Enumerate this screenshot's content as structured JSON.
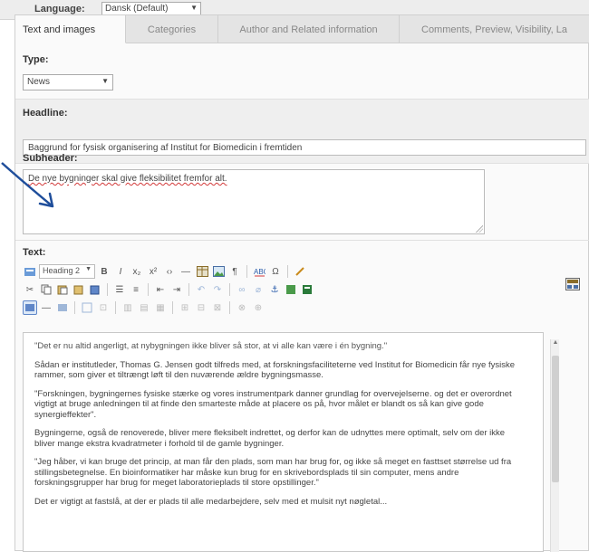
{
  "language": {
    "label": "Language:",
    "value": "Dansk (Default)"
  },
  "tabs": [
    {
      "label": "Text and images"
    },
    {
      "label": "Categories"
    },
    {
      "label": "Author and Related information"
    },
    {
      "label": "Comments, Preview, Visibility, La"
    }
  ],
  "type": {
    "label": "Type:",
    "value": "News"
  },
  "headline": {
    "label": "Headline:",
    "value": "Baggrund for fysisk organisering af Institut for Biomedicin i fremtiden"
  },
  "subheader": {
    "label": "Subheader:",
    "value": "De nye bygninger skal give fleksibilitet fremfor alt."
  },
  "text": {
    "label": "Text:",
    "format": "Heading 2",
    "paragraphs": [
      "\"Det er nu altid angerligt, at nybygningen ikke bliver så stor, at vi alle kan være i én bygning.\"",
      "Sådan er institutleder, Thomas G. Jensen godt tilfreds med, at forskningsfaciliteterne ved Institut for Biomedicin får nye fysiske rammer, som giver et tiltrængt løft til den nuværende ældre bygningsmasse.",
      "\"Forskningen, bygningernes fysiske stærke og  vores instrumentpark danner grundlag for overvejelserne.  og det er overordnet vigtigt at bruge anledningen til at finde den smarteste måde at placere os på, hvor målet er blandt os så kan give gode synergieffekter\".",
      "Bygningerne, også de renoverede, bliver mere fleksibelt indrettet, og derfor kan de udnyttes mere optimalt, selv om der ikke bliver mange ekstra kvadratmeter i forhold til de gamle bygninger.",
      "\"Jeg håber, vi kan bruge det princip, at man får den plads, som man har brug for, og ikke så meget en fasttset størrelse ud fra stillingsbetegnelse. En bioinformatiker har måske kun brug for en skrivebordsplads til sin computer, mens andre forskningsgrupper har brug for meget laboratorieplads til store opstillinger.\"",
      "Det er vigtigt at fastslå, at der er plads til alle medarbejdere, selv med et mulsit nyt nøgletal..."
    ]
  },
  "icons": {
    "toolbar1": [
      "format-select",
      "bold-icon",
      "italic-icon",
      "subscript-icon",
      "superscript-icon",
      "horizontal-rule-icon",
      "table-icon",
      "image-icon",
      "paragraph-icon",
      "spellcheck-icon",
      "special-char-icon",
      "pen-icon"
    ],
    "toolbar2": [
      "cut-icon",
      "copy-icon",
      "paste-icon",
      "paste-text-icon",
      "paste-word-icon",
      "unordered-list-icon",
      "ordered-list-icon",
      "outdent-icon",
      "indent-icon",
      "undo-icon",
      "redo-icon",
      "link-icon",
      "unlink-icon",
      "anchor-icon",
      "media-icon"
    ],
    "toolbar3": [
      "edit-html-icon",
      "insert-line-icon",
      "align-icon",
      "cleanup-icon",
      "fullscreen-icon",
      "column-icon",
      "row-icon",
      "merge-icon",
      "split-icon",
      "cell-props-icon"
    ]
  },
  "colors": {
    "arrow": "#1f4e9b",
    "spell_error": "#d23a3a"
  }
}
